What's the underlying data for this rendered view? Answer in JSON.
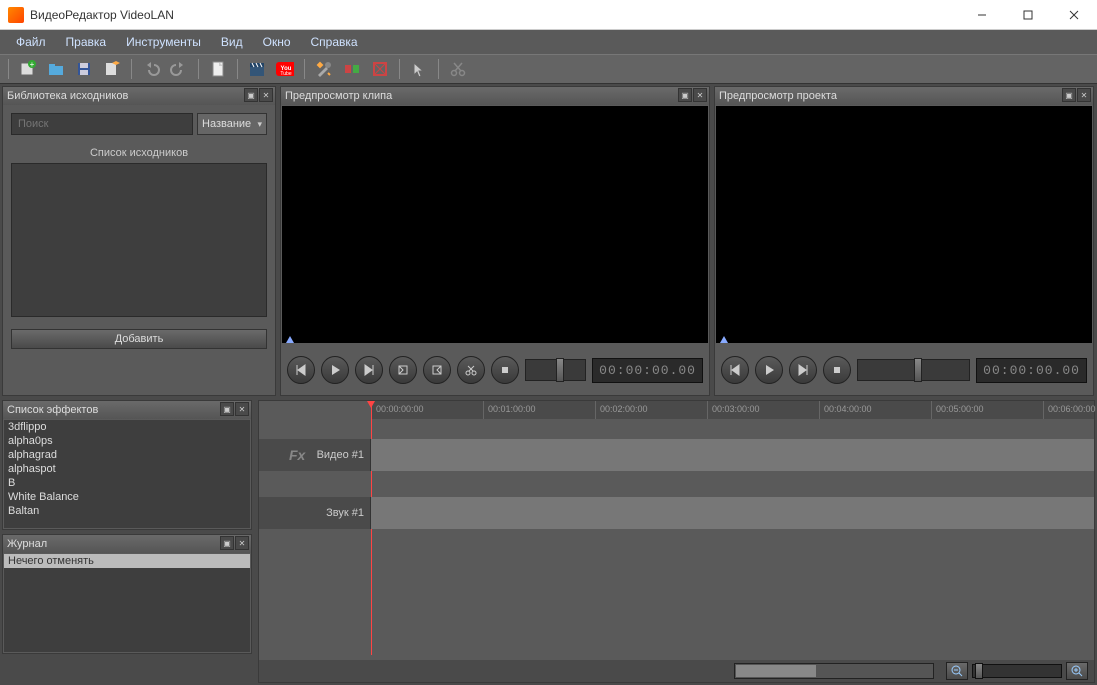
{
  "window": {
    "title": "ВидеоРедактор VideoLAN"
  },
  "menu": {
    "file": "Файл",
    "edit": "Правка",
    "tools": "Инструменты",
    "view": "Вид",
    "window": "Окно",
    "help": "Справка"
  },
  "panels": {
    "library": {
      "title": "Библиотека исходников",
      "search_ph": "Поиск",
      "sort_label": "Название",
      "list_label": "Список исходников",
      "add_btn": "Добавить"
    },
    "clip_preview": {
      "title": "Предпросмотр клипа",
      "timecode": "00:00:00.00"
    },
    "project_preview": {
      "title": "Предпросмотр проекта",
      "timecode": "00:00:00.00"
    },
    "effects": {
      "title": "Список эффектов",
      "items": [
        "3dflippo",
        "alpha0ps",
        "alphagrad",
        "alphaspot",
        "B",
        "White Balance",
        "Baltan"
      ]
    },
    "journal": {
      "title": "Журнал",
      "last": "Нечего отменять"
    }
  },
  "timeline": {
    "ticks": [
      "00:00:00:00",
      "00:01:00:00",
      "00:02:00:00",
      "00:03:00:00",
      "00:04:00:00",
      "00:05:00:00",
      "00:06:00:00"
    ],
    "video_track": "Видео #1",
    "audio_track": "Звук #1",
    "fx_label": "Fx"
  }
}
